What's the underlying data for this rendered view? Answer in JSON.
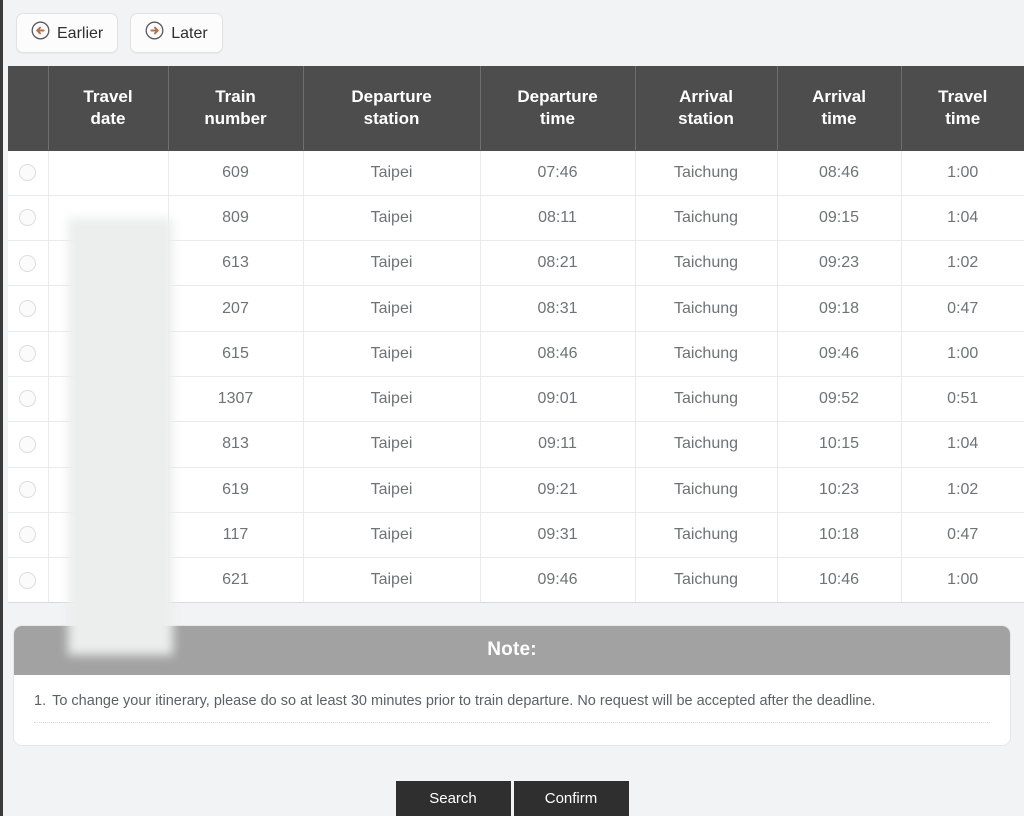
{
  "nav": {
    "earlier": {
      "label": "Earlier",
      "icon": "arrow-circle-left-icon"
    },
    "later": {
      "label": "Later",
      "icon": "arrow-circle-right-icon"
    }
  },
  "colors": {
    "header_bg": "#4d4d4d",
    "note_header_bg": "#a2a2a2",
    "page_bg": "#f2f3f5",
    "action_button_bg": "#2f2f2f",
    "icon_accent": "#b5714a"
  },
  "table": {
    "columns": [
      {
        "key": "select",
        "label": ""
      },
      {
        "key": "travel_date",
        "label": "Travel\ndate",
        "line1": "Travel",
        "line2": "date"
      },
      {
        "key": "train_number",
        "label": "Train\nnumber",
        "line1": "Train",
        "line2": "number"
      },
      {
        "key": "departure_station",
        "label": "Departure\nstation",
        "line1": "Departure",
        "line2": "station"
      },
      {
        "key": "departure_time",
        "label": "Departure\ntime",
        "line1": "Departure",
        "line2": "time"
      },
      {
        "key": "arrival_station",
        "label": "Arrival\nstation",
        "line1": "Arrival",
        "line2": "station"
      },
      {
        "key": "arrival_time",
        "label": "Arrival\ntime",
        "line1": "Arrival",
        "line2": "time"
      },
      {
        "key": "travel_time",
        "label": "Travel\ntime",
        "line1": "Travel",
        "line2": "time"
      }
    ],
    "rows": [
      {
        "selected": false,
        "travel_date": "",
        "train_number": "609",
        "departure_station": "Taipei",
        "departure_time": "07:46",
        "arrival_station": "Taichung",
        "arrival_time": "08:46",
        "travel_time": "1:00"
      },
      {
        "selected": false,
        "travel_date": "",
        "train_number": "809",
        "departure_station": "Taipei",
        "departure_time": "08:11",
        "arrival_station": "Taichung",
        "arrival_time": "09:15",
        "travel_time": "1:04"
      },
      {
        "selected": false,
        "travel_date": "",
        "train_number": "613",
        "departure_station": "Taipei",
        "departure_time": "08:21",
        "arrival_station": "Taichung",
        "arrival_time": "09:23",
        "travel_time": "1:02"
      },
      {
        "selected": false,
        "travel_date": "",
        "train_number": "207",
        "departure_station": "Taipei",
        "departure_time": "08:31",
        "arrival_station": "Taichung",
        "arrival_time": "09:18",
        "travel_time": "0:47"
      },
      {
        "selected": false,
        "travel_date": "",
        "train_number": "615",
        "departure_station": "Taipei",
        "departure_time": "08:46",
        "arrival_station": "Taichung",
        "arrival_time": "09:46",
        "travel_time": "1:00"
      },
      {
        "selected": false,
        "travel_date": "",
        "train_number": "1307",
        "departure_station": "Taipei",
        "departure_time": "09:01",
        "arrival_station": "Taichung",
        "arrival_time": "09:52",
        "travel_time": "0:51"
      },
      {
        "selected": false,
        "travel_date": "",
        "train_number": "813",
        "departure_station": "Taipei",
        "departure_time": "09:11",
        "arrival_station": "Taichung",
        "arrival_time": "10:15",
        "travel_time": "1:04"
      },
      {
        "selected": false,
        "travel_date": "",
        "train_number": "619",
        "departure_station": "Taipei",
        "departure_time": "09:21",
        "arrival_station": "Taichung",
        "arrival_time": "10:23",
        "travel_time": "1:02"
      },
      {
        "selected": false,
        "travel_date": "",
        "train_number": "117",
        "departure_station": "Taipei",
        "departure_time": "09:31",
        "arrival_station": "Taichung",
        "arrival_time": "10:18",
        "travel_time": "0:47"
      },
      {
        "selected": false,
        "travel_date": "",
        "train_number": "621",
        "departure_station": "Taipei",
        "departure_time": "09:46",
        "arrival_station": "Taichung",
        "arrival_time": "10:46",
        "travel_time": "1:00"
      }
    ]
  },
  "note": {
    "title": "Note:",
    "items": [
      {
        "num": "1.",
        "text": "To change your itinerary, please do so at least 30 minutes prior to train departure. No request will be accepted after the deadline."
      }
    ]
  },
  "actions": {
    "search": "Search",
    "confirm": "Confirm"
  }
}
